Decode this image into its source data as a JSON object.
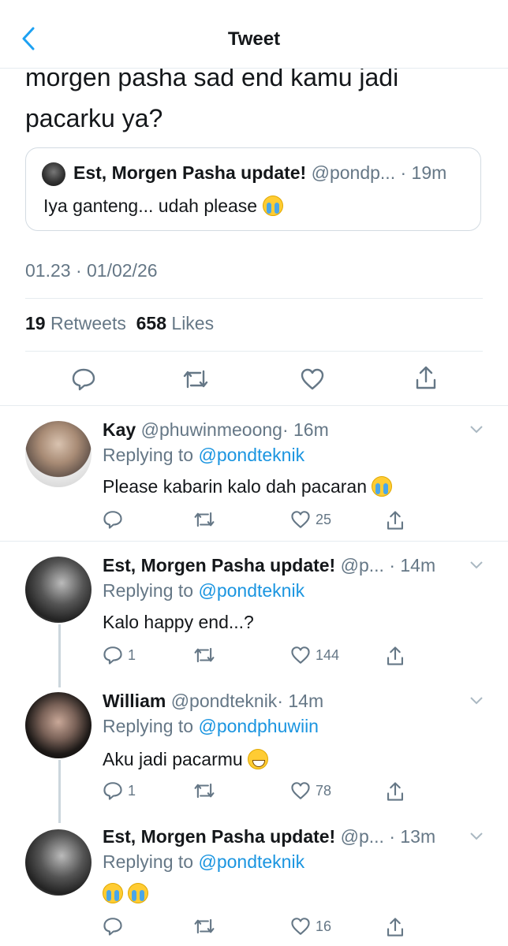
{
  "header": {
    "title": "Tweet"
  },
  "tweet": {
    "text": "morgen pasha sad end kamu jadi pacarku ya?",
    "quote": {
      "name": "Est, Morgen Pasha update!",
      "handle": "@pondp...",
      "time": "· 19m",
      "text": "Iya ganteng... udah please"
    },
    "timestamp": "01.23 · 01/02/26",
    "retweets_count": "19",
    "retweets_label": "Retweets",
    "likes_count": "658",
    "likes_label": "Likes"
  },
  "replies": [
    {
      "name": "Kay",
      "handle": "@phuwinmeoong",
      "time": "· 16m",
      "replying_prefix": "Replying to",
      "replying_to": "@pondteknik",
      "text": "Please kabarin kalo dah pacaran",
      "reply_count": "",
      "like_count": "25"
    },
    {
      "name": "Est, Morgen Pasha update!",
      "handle": "@p...",
      "time": "· 14m",
      "replying_prefix": "Replying to",
      "replying_to": "@pondteknik",
      "text": "Kalo happy end...?",
      "reply_count": "1",
      "like_count": "144"
    },
    {
      "name": "William",
      "handle": "@pondteknik",
      "time": "· 14m",
      "replying_prefix": "Replying to",
      "replying_to": "@pondphuwiin",
      "text": "Aku jadi pacarmu",
      "reply_count": "1",
      "like_count": "78"
    },
    {
      "name": "Est, Morgen Pasha update!",
      "handle": "@p...",
      "time": "· 13m",
      "replying_prefix": "Replying to",
      "replying_to": "@pondteknik",
      "text": "",
      "reply_count": "",
      "like_count": "16"
    }
  ],
  "colors": {
    "link": "#1b95e0",
    "secondary": "#657786",
    "divider": "#e6ecf0"
  },
  "icons": [
    "back-chevron-icon",
    "reply-icon",
    "retweet-icon",
    "like-icon",
    "share-icon",
    "more-chevron-icon"
  ]
}
